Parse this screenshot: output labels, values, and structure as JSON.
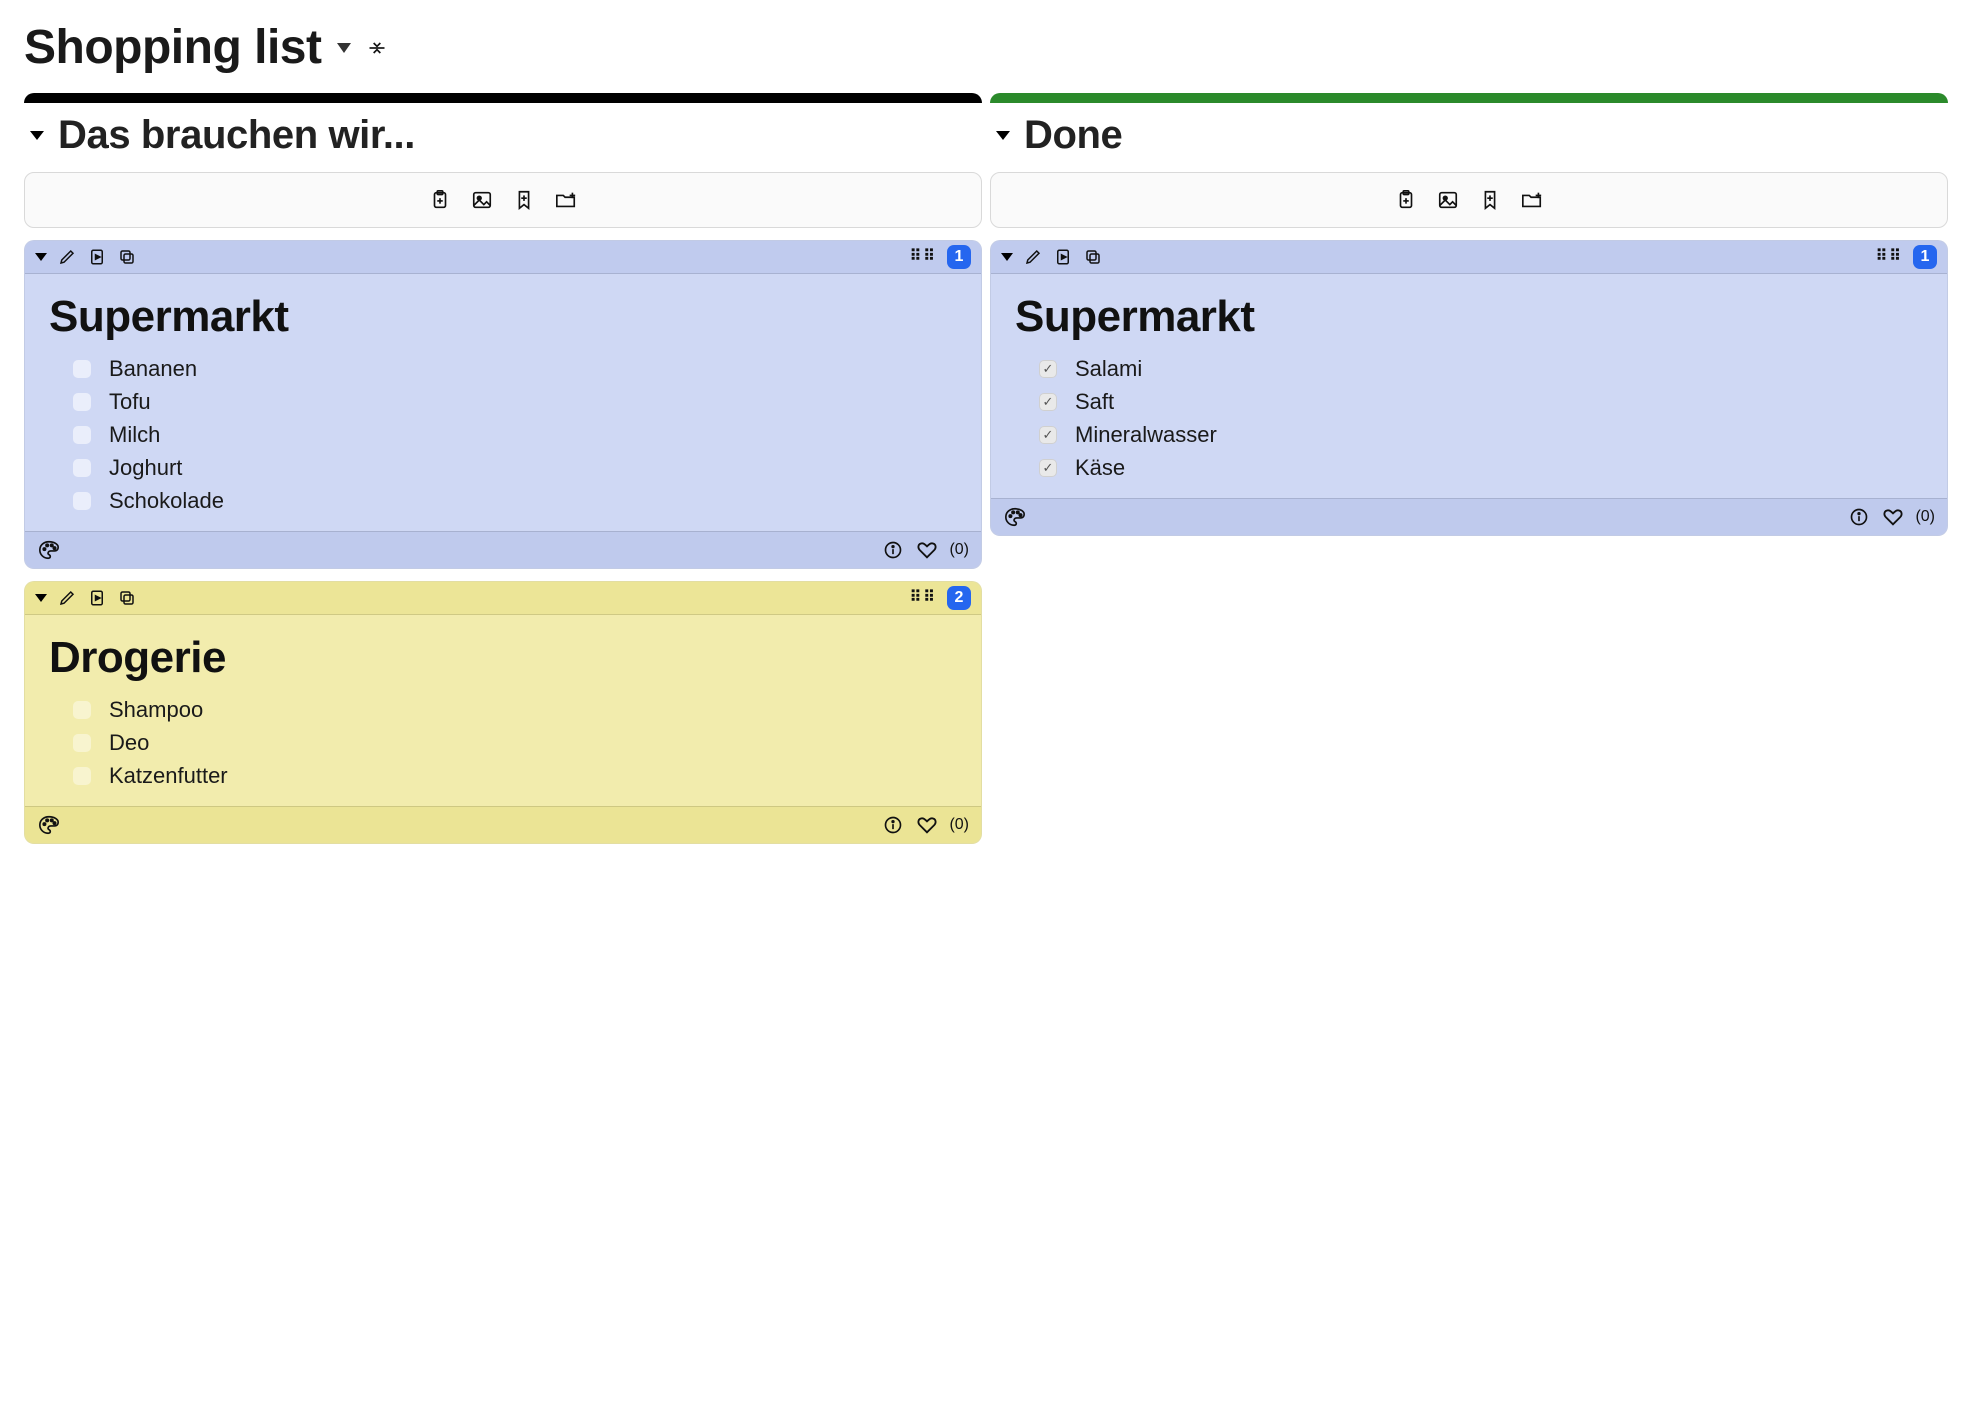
{
  "page": {
    "title": "Shopping list"
  },
  "columns": [
    {
      "id": "need",
      "title": "Das brauchen wir...",
      "bar_color": "black",
      "cards": [
        {
          "color": "blue",
          "badge": "1",
          "title": "Supermarkt",
          "likes_label": "(0)",
          "items": [
            {
              "label": "Bananen",
              "checked": false
            },
            {
              "label": "Tofu",
              "checked": false
            },
            {
              "label": "Milch",
              "checked": false
            },
            {
              "label": "Joghurt",
              "checked": false
            },
            {
              "label": "Schokolade",
              "checked": false
            }
          ]
        },
        {
          "color": "yellow",
          "badge": "2",
          "title": "Drogerie",
          "likes_label": "(0)",
          "items": [
            {
              "label": "Shampoo",
              "checked": false
            },
            {
              "label": "Deo",
              "checked": false
            },
            {
              "label": "Katzenfutter",
              "checked": false
            }
          ]
        }
      ]
    },
    {
      "id": "done",
      "title": "Done",
      "bar_color": "green",
      "cards": [
        {
          "color": "blue",
          "badge": "1",
          "title": "Supermarkt",
          "likes_label": "(0)",
          "items": [
            {
              "label": "Salami",
              "checked": true
            },
            {
              "label": "Saft",
              "checked": true
            },
            {
              "label": "Mineralwasser",
              "checked": true
            },
            {
              "label": "Käse",
              "checked": true
            }
          ]
        }
      ]
    }
  ]
}
